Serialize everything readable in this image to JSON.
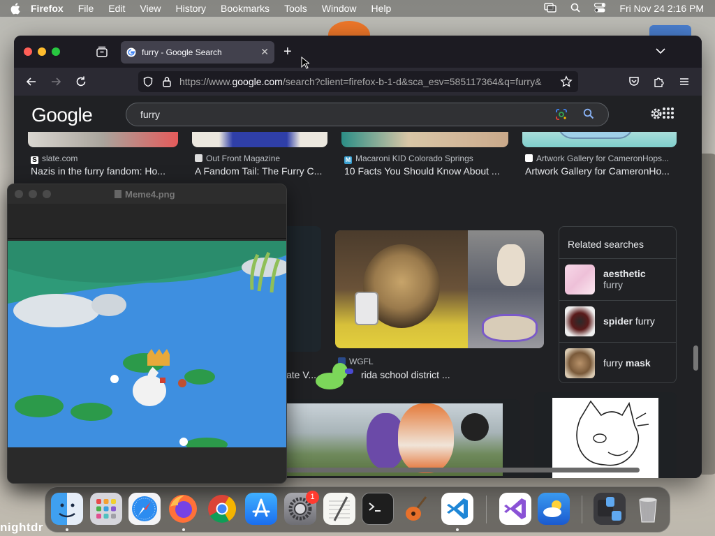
{
  "menubar": {
    "app_name": "Firefox",
    "items": [
      "File",
      "Edit",
      "View",
      "History",
      "Bookmarks",
      "Tools",
      "Window",
      "Help"
    ],
    "clock": "Fri Nov 24  2:16 PM"
  },
  "browser": {
    "tab_title": "furry - Google Search",
    "url_prefix": "https://www.",
    "url_host": "google.com",
    "url_path": "/search?client=firefox-b-1-d&sca_esv=585117364&q=furry&"
  },
  "google": {
    "logo": "Google",
    "query": "furry",
    "results_top": [
      {
        "source": "slate.com",
        "title": "Nazis in the furry fandom: Ho..."
      },
      {
        "source": "Out Front Magazine",
        "title": "A Fandom Tail: The Furry C..."
      },
      {
        "source": "Macaroni KID Colorado Springs",
        "title": "10 Facts You Should Know About ..."
      },
      {
        "source": "Artwork Gallery for CameronHops...",
        "title": "Artwork Gallery for CameronHo..."
      }
    ],
    "results_mid": [
      {
        "source": "",
        "title": "ate V..."
      },
      {
        "source": "WGFL",
        "title": "rida school district ..."
      }
    ],
    "related": {
      "title": "Related searches",
      "items": [
        {
          "bold": "aesthetic",
          "rest": "furry"
        },
        {
          "bold": "spider",
          "rest": "furry"
        },
        {
          "pre": "furry",
          "bold": "mask"
        }
      ]
    }
  },
  "preview": {
    "title": "Meme4.png"
  },
  "dock": {
    "badge_count": "1"
  },
  "wallpaper_text": "nightdr"
}
